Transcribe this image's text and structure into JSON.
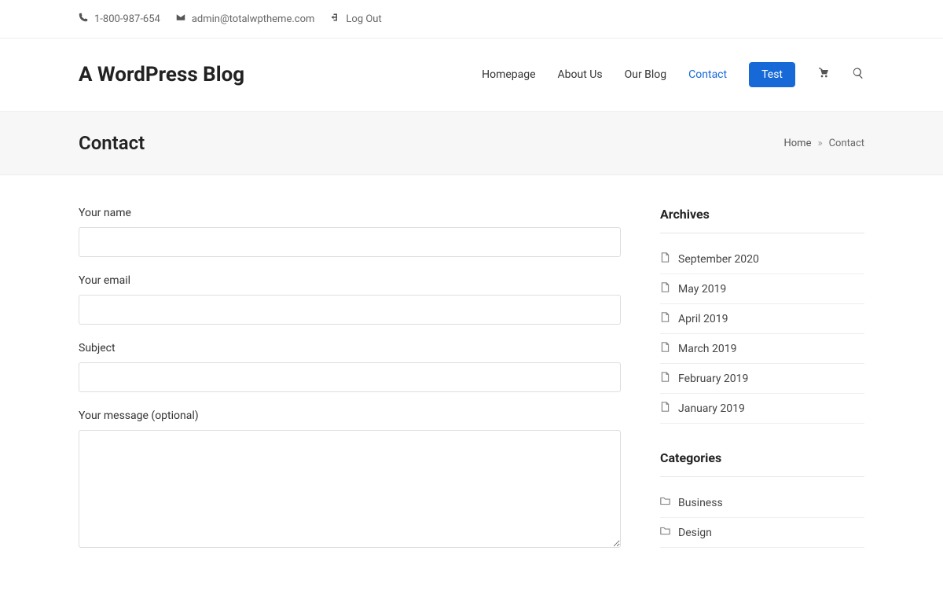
{
  "topbar": {
    "phone": "1-800-987-654",
    "email": "admin@totalwptheme.com",
    "logout": "Log Out"
  },
  "siteTitle": "A WordPress Blog",
  "nav": {
    "homepage": "Homepage",
    "about": "About Us",
    "blog": "Our Blog",
    "contact": "Contact",
    "test": "Test"
  },
  "page": {
    "title": "Contact",
    "breadcrumb_home": "Home",
    "breadcrumb_sep": "»",
    "breadcrumb_current": "Contact"
  },
  "form": {
    "name_label": "Your name",
    "email_label": "Your email",
    "subject_label": "Subject",
    "message_label": "Your message (optional)"
  },
  "sidebar": {
    "archives_title": "Archives",
    "archives": {
      "a0": "September 2020",
      "a1": "May 2019",
      "a2": "April 2019",
      "a3": "March 2019",
      "a4": "February 2019",
      "a5": "January 2019"
    },
    "categories_title": "Categories",
    "categories": {
      "c0": "Business",
      "c1": "Design"
    }
  }
}
